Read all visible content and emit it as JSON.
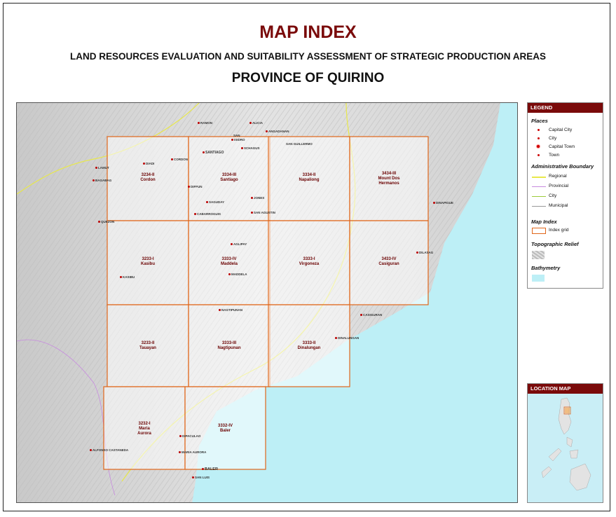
{
  "header": {
    "title": "MAP INDEX",
    "subtitle": "LAND RESOURCES EVALUATION AND SUITABILITY ASSESSMENT OF STRATEGIC PRODUCTION AREAS",
    "province": "PROVINCE OF QUIRINO"
  },
  "colors": {
    "title": "#7a0a0a",
    "grid": "#e0661a",
    "sea": "#bfeff5",
    "legend_head": "#7a0a0a"
  },
  "grid_cells": [
    {
      "code": "3234-II",
      "name": "Cordon"
    },
    {
      "code": "3334-III",
      "name": "Santiago"
    },
    {
      "code": "3334-II",
      "name": "Napaliong"
    },
    {
      "code": "3434-III",
      "name": "Mount Dos Hermanos"
    },
    {
      "code": "3233-I",
      "name": "Kasibu"
    },
    {
      "code": "3333-IV",
      "name": "Maddela"
    },
    {
      "code": "3333-I",
      "name": "Virgoneza"
    },
    {
      "code": "3433-IV",
      "name": "Casiguran"
    },
    {
      "code": "3233-II",
      "name": "Tauayan"
    },
    {
      "code": "3333-III",
      "name": "Nagtipunan"
    },
    {
      "code": "3333-II",
      "name": "Dinalungan"
    },
    {
      "code": "3232-I",
      "name": "Maria Aurora"
    },
    {
      "code": "3332-IV",
      "name": "Baler"
    }
  ],
  "places": [
    {
      "name": "RAMON"
    },
    {
      "name": "ALICIA"
    },
    {
      "name": "ANGADANAN"
    },
    {
      "name": "SAN"
    },
    {
      "name": "ISIDRO"
    },
    {
      "name": "SCHAGUS"
    },
    {
      "name": "SAN GUILLERMO"
    },
    {
      "name": "SANTIAGO"
    },
    {
      "name": "CORDON"
    },
    {
      "name": "DIADI"
    },
    {
      "name": "LAMUT"
    },
    {
      "name": "BAGABAG"
    },
    {
      "name": "DIFFUN"
    },
    {
      "name": "SAGUDAY"
    },
    {
      "name": "JONES"
    },
    {
      "name": "CABARROGUIS"
    },
    {
      "name": "SAN AGUSTIN"
    },
    {
      "name": "QUEZON"
    },
    {
      "name": "AGLIPAY"
    },
    {
      "name": "MADDELA"
    },
    {
      "name": "KASIBU"
    },
    {
      "name": "DINAPIGUE"
    },
    {
      "name": "DILASAG"
    },
    {
      "name": "CASIGURAN"
    },
    {
      "name": "NAGTIPUNAN"
    },
    {
      "name": "DINALUNGAN"
    },
    {
      "name": "DIPACULAO"
    },
    {
      "name": "MARIA AURORA"
    },
    {
      "name": "BALER"
    },
    {
      "name": "SAN LUIS"
    },
    {
      "name": "ALFONSO CASTANEDA"
    }
  ],
  "legend": {
    "title": "LEGEND",
    "places_title": "Places",
    "places": [
      "Capital City",
      "City",
      "Capital Town",
      "Town"
    ],
    "admin_title": "Administrative Boundary",
    "admin": [
      "Regional",
      "Provincial",
      "City",
      "Municipal"
    ],
    "index_title": "Map Index",
    "index_item": "Index grid",
    "relief_title": "Topographic Relief",
    "bathy_title": "Bathymetry"
  },
  "location_map": {
    "title": "LOCATION MAP"
  }
}
